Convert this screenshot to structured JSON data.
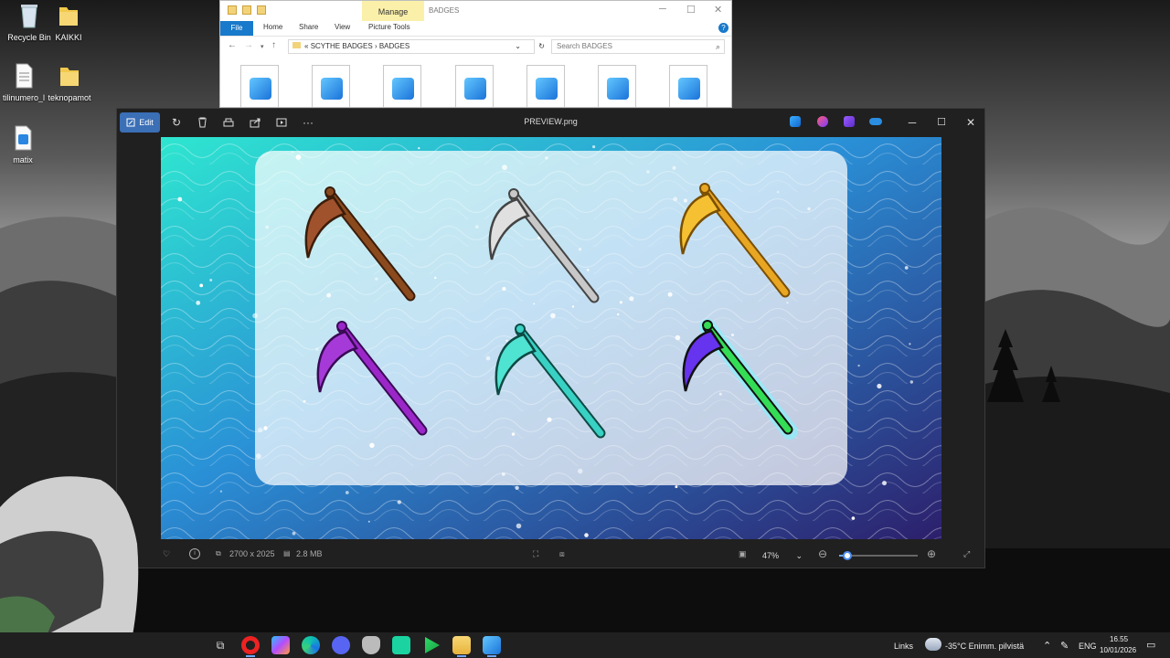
{
  "desktop": {
    "icons": [
      {
        "label": "Recycle Bin"
      },
      {
        "label": "KAIKKI"
      },
      {
        "label": "tilinumero_l"
      },
      {
        "label": "teknopamot"
      },
      {
        "label": "matix"
      }
    ]
  },
  "explorer": {
    "manage_tab": "Manage",
    "title": "BADGES",
    "tabs": [
      "File",
      "Home",
      "Share",
      "View",
      "Picture Tools"
    ],
    "help": "?",
    "address": {
      "prefix": "«",
      "parts": [
        "SCYTHE BADGES",
        "BADGES"
      ],
      "separator": "›"
    },
    "search_placeholder": "Search BADGES",
    "file_count": 7
  },
  "viewer": {
    "edit_label": "Edit",
    "filename": "PREVIEW.png",
    "dimensions": "2700 x 2025",
    "filesize": "2.8 MB",
    "zoom": "47%",
    "zoom_slider_value": 0.08,
    "toolbar_icons": [
      "rotate-icon",
      "delete-icon",
      "print-icon",
      "share-icon",
      "slideshow-icon",
      "more-icon"
    ]
  },
  "image": {
    "scythes": [
      {
        "name": "bronze",
        "handle": "#8b4a1e",
        "blade": "#a0522d",
        "edge": "#3b1d0a"
      },
      {
        "name": "silver",
        "handle": "#c8c8c8",
        "blade": "#e0e0e0",
        "edge": "#444444"
      },
      {
        "name": "gold",
        "handle": "#e8a623",
        "blade": "#f5c133",
        "edge": "#7a4f00"
      },
      {
        "name": "amethyst",
        "handle": "#9b27c9",
        "blade": "#a63ad8",
        "edge": "#3a0a55"
      },
      {
        "name": "diamond",
        "handle": "#38d1c4",
        "blade": "#4fe3d2",
        "edge": "#0d4a44"
      },
      {
        "name": "rainbow",
        "handle": "#33dd55",
        "blade": "#6633ee",
        "edge": "#111111"
      }
    ],
    "colors": {
      "gradient_start": "#2ee6d0",
      "gradient_mid": "#2a8fd6",
      "gradient_end": "#2c1f6b",
      "card": "#ffffff"
    }
  },
  "taskbar": {
    "links_label": "Links",
    "weather": "-35°C  Enimm. pilvistä",
    "language": "ENG",
    "time": "16.55",
    "date": "10/01/2026"
  }
}
